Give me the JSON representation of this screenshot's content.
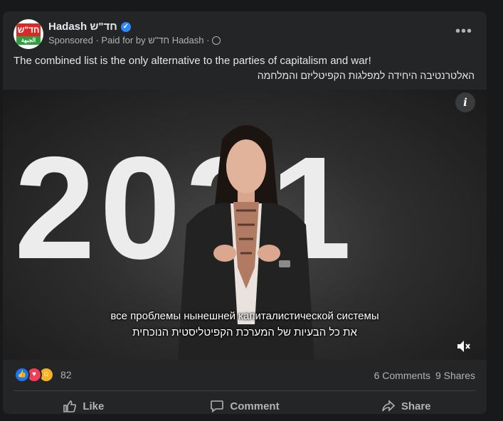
{
  "post": {
    "page_name": "Hadash חד\"ש",
    "avatar_logo_top": "חד\"ש",
    "avatar_logo_bottom": "الجبهة",
    "sponsored_label": "Sponsored · Paid for by חד\"ש Hadash ·",
    "text_en": "The combined list is the only alternative to the parties of capitalism and war!",
    "text_he": "האלטרנטיבה היחידה למפלגות הקפיטליזם והמלחמה"
  },
  "video": {
    "big_text": "2021",
    "subtitle_ru": "все проблемы нынешней капиталистической системы",
    "subtitle_he": "את כל הבעיות של המערכת הקפיטליסטית הנוכחית",
    "info_label": "i",
    "muted": true
  },
  "engagement": {
    "reaction_icons": [
      "like-icon",
      "love-icon",
      "haha-icon"
    ],
    "reaction_count": "82",
    "comments": "6 Comments",
    "shares": "9 Shares"
  },
  "actions": {
    "like": "Like",
    "comment": "Comment",
    "share": "Share"
  },
  "colors": {
    "card_bg": "#242526",
    "page_bg": "#18191a",
    "verified": "#2d88ff",
    "like": "#1877f2",
    "love": "#f33e58",
    "haha": "#f7b125"
  }
}
